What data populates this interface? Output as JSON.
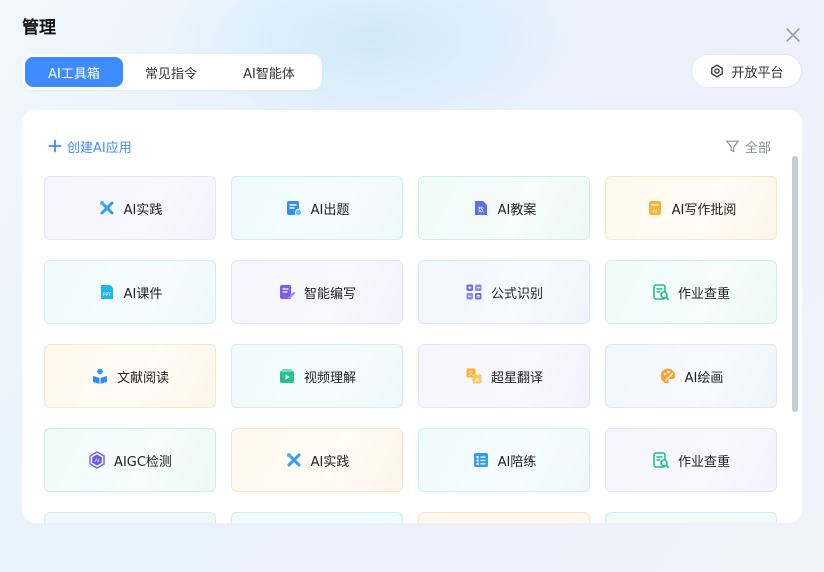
{
  "dialog": {
    "title": "管理"
  },
  "tabs": [
    {
      "label": "AI工具箱",
      "active": true
    },
    {
      "label": "常见指令",
      "active": false
    },
    {
      "label": "AI智能体",
      "active": false
    }
  ],
  "header": {
    "open_platform_label": "开放平台"
  },
  "toolbar": {
    "create_label": "创建AI应用",
    "filter_label": "全部"
  },
  "tools": [
    {
      "label": "AI实践",
      "icon": "tools-icon",
      "theme": "purple"
    },
    {
      "label": "AI出题",
      "icon": "edit-doc-icon",
      "theme": "cyan"
    },
    {
      "label": "AI教案",
      "icon": "lesson-plan-icon",
      "theme": "green"
    },
    {
      "label": "AI写作批阅",
      "icon": "writing-review-icon",
      "theme": "orange"
    },
    {
      "label": "AI课件",
      "icon": "ppt-icon",
      "theme": "cyan"
    },
    {
      "label": "智能编写",
      "icon": "smart-write-icon",
      "theme": "purple"
    },
    {
      "label": "公式识别",
      "icon": "formula-icon",
      "theme": "blue"
    },
    {
      "label": "作业查重",
      "icon": "plagiarism-check-icon",
      "theme": "green"
    },
    {
      "label": "文献阅读",
      "icon": "reading-icon",
      "theme": "orange"
    },
    {
      "label": "视频理解",
      "icon": "video-icon",
      "theme": "cyan"
    },
    {
      "label": "超星翻译",
      "icon": "translate-icon",
      "theme": "purple"
    },
    {
      "label": "AI绘画",
      "icon": "palette-icon",
      "theme": "blue"
    },
    {
      "label": "AIGC检测",
      "icon": "aigc-detect-icon",
      "theme": "green"
    },
    {
      "label": "AI实践",
      "icon": "tools-icon",
      "theme": "orange"
    },
    {
      "label": "AI陪练",
      "icon": "practice-icon",
      "theme": "cyan"
    },
    {
      "label": "作业查重",
      "icon": "plagiarism-check-icon",
      "theme": "purple"
    }
  ],
  "colors": {
    "accent": "#3e8bff",
    "text": "#222222",
    "muted": "#8a8f99"
  }
}
